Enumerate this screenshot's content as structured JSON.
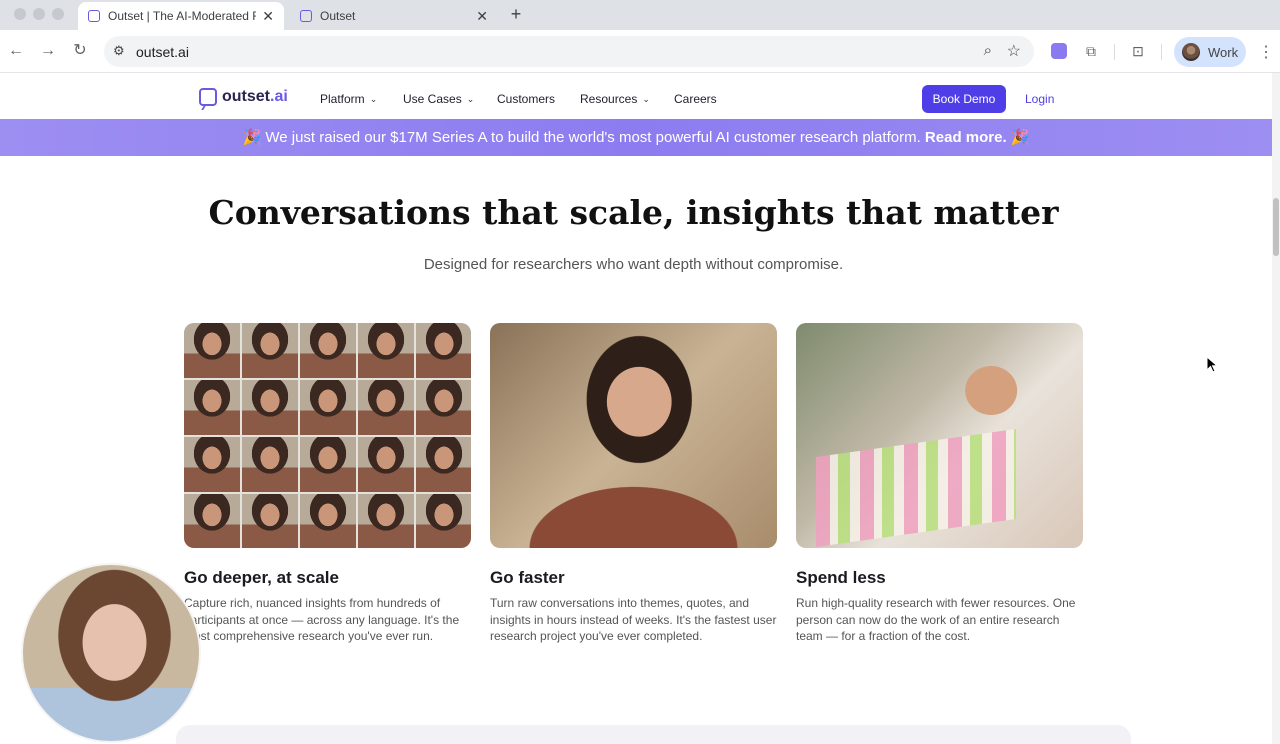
{
  "browser": {
    "tabs": [
      {
        "title": "Outset | The AI-Moderated Re",
        "active": true
      },
      {
        "title": "Outset",
        "active": false
      }
    ],
    "address": "outset.ai",
    "profile_label": "Work"
  },
  "site": {
    "logo_text": "outset",
    "logo_suffix": ".ai",
    "nav": [
      {
        "label": "Platform",
        "has_dropdown": true
      },
      {
        "label": "Use Cases",
        "has_dropdown": true
      },
      {
        "label": "Customers",
        "has_dropdown": false
      },
      {
        "label": "Resources",
        "has_dropdown": true
      },
      {
        "label": "Careers",
        "has_dropdown": false
      }
    ],
    "book_demo": "Book Demo",
    "login": "Login"
  },
  "banner": {
    "emoji": "🎉",
    "text": "We just raised our $17M Series A to build the world's most powerful AI customer research platform.",
    "link": "Read more."
  },
  "hero": {
    "headline": "Conversations that scale, insights that matter",
    "subline": "Designed for researchers who want depth without compromise."
  },
  "cards": [
    {
      "title": "Go deeper, at scale",
      "text": "Capture rich, nuanced insights from hundreds of participants at once — across any language. It's the most comprehensive research you've ever run."
    },
    {
      "title": "Go faster",
      "text": "Turn raw conversations into themes, quotes, and insights in hours instead of weeks. It's the fastest user research project you've ever completed."
    },
    {
      "title": "Spend less",
      "text": "Run high-quality research with fewer resources. One person can now do the work of an entire research team — for a fraction of the cost."
    }
  ],
  "colors": {
    "brand": "#4f3ee8",
    "banner": "#8c7cf0"
  }
}
